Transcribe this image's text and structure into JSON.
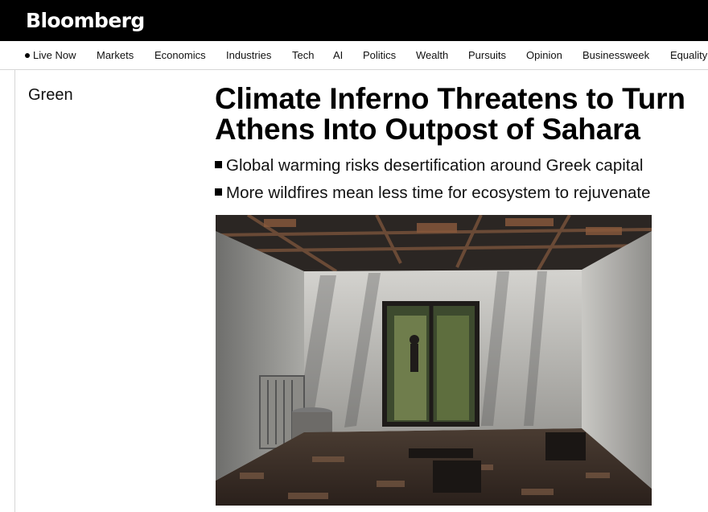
{
  "header": {
    "logo": "Bloomberg"
  },
  "nav": {
    "items": [
      {
        "label": "Live Now",
        "live": true
      },
      {
        "label": "Markets"
      },
      {
        "label": "Economics"
      },
      {
        "label": "Industries"
      },
      {
        "label": "Tech"
      },
      {
        "label": "AI"
      },
      {
        "label": "Politics"
      },
      {
        "label": "Wealth"
      },
      {
        "label": "Pursuits"
      },
      {
        "label": "Opinion"
      },
      {
        "label": "Businessweek"
      },
      {
        "label": "Equality"
      }
    ]
  },
  "article": {
    "section": "Green",
    "headline_line1": "Climate Inferno Threatens to Turn",
    "headline_line2": "Athens Into Outpost of Sahara",
    "bullets": [
      "Global warming risks desertification around Greek capital",
      "More wildfires mean less time for ecosystem to rejuvenate"
    ]
  },
  "colors": {
    "topbar": "#000000",
    "text": "#000000",
    "divider": "#d6d6d6"
  }
}
